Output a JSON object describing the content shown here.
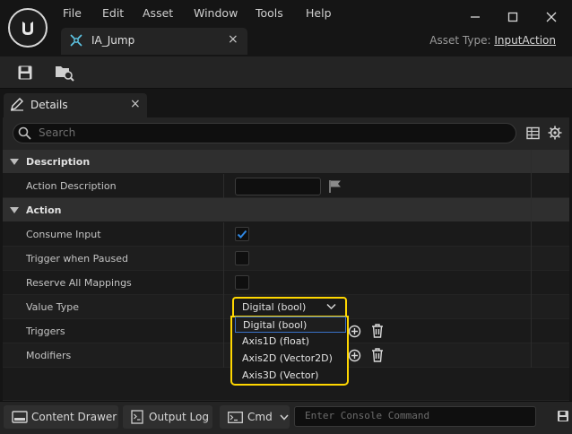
{
  "menu": [
    "File",
    "Edit",
    "Asset",
    "Window",
    "Tools",
    "Help"
  ],
  "document_tab": {
    "label": "IA_Jump",
    "close": "×"
  },
  "asset_type": {
    "label": "Asset Type:",
    "value": "InputAction"
  },
  "toolbar": {
    "icons": [
      "save-icon",
      "browse-icon"
    ]
  },
  "details_tab": {
    "label": "Details",
    "close": "×"
  },
  "search": {
    "placeholder": "Search"
  },
  "categories": {
    "description": "Description",
    "action": "Action"
  },
  "properties": {
    "action_description": {
      "label": "Action Description",
      "value": ""
    },
    "consume_input": {
      "label": "Consume Input",
      "checked": true
    },
    "trigger_when_paused": {
      "label": "Trigger when Paused",
      "checked": false
    },
    "reserve_all_mappings": {
      "label": "Reserve All Mappings",
      "checked": false
    },
    "value_type": {
      "label": "Value Type",
      "selected": "Digital (bool)"
    },
    "triggers": {
      "label": "Triggers"
    },
    "modifiers": {
      "label": "Modifiers"
    }
  },
  "value_type_options": [
    "Digital (bool)",
    "Axis1D (float)",
    "Axis2D (Vector2D)",
    "Axis3D (Vector)"
  ],
  "bottom_bar": {
    "content_drawer": "Content Drawer",
    "output_log": "Output Log",
    "cmd": "Cmd",
    "console_placeholder": "Enter Console Command"
  },
  "colors": {
    "accent_yellow": "#ffd700",
    "check_blue": "#2f86e0",
    "highlight_blue": "#3a72c8"
  }
}
